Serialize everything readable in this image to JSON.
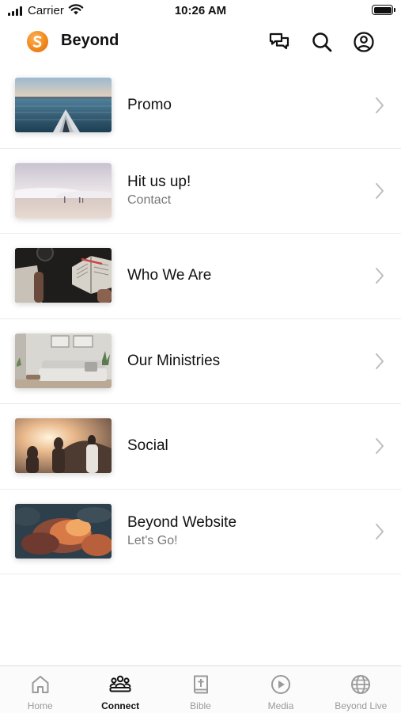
{
  "status_bar": {
    "carrier": "Carrier",
    "time": "10:26 AM"
  },
  "header": {
    "title": "Beyond",
    "icons": [
      "chat-icon",
      "search-icon",
      "account-icon"
    ]
  },
  "list": {
    "items": [
      {
        "title": "Promo",
        "subtitle": "",
        "thumbnail": "kayak-on-water-image"
      },
      {
        "title": "Hit us up!",
        "subtitle": "Contact",
        "thumbnail": "beach-waves-image"
      },
      {
        "title": "Who We Are",
        "subtitle": "",
        "thumbnail": "open-bible-image"
      },
      {
        "title": "Our Ministries",
        "subtitle": "",
        "thumbnail": "living-room-image"
      },
      {
        "title": "Social",
        "subtitle": "",
        "thumbnail": "friends-sunset-image"
      },
      {
        "title": "Beyond Website",
        "subtitle": "Let's Go!",
        "thumbnail": "sunset-clouds-image"
      }
    ]
  },
  "tab_bar": {
    "tabs": [
      {
        "label": "Home",
        "icon": "home-icon",
        "active": false
      },
      {
        "label": "Connect",
        "icon": "people-icon",
        "active": true
      },
      {
        "label": "Bible",
        "icon": "bible-icon",
        "active": false
      },
      {
        "label": "Media",
        "icon": "play-icon",
        "active": false
      },
      {
        "label": "Beyond Live",
        "icon": "globe-icon",
        "active": false
      }
    ]
  },
  "colors": {
    "brand": "#f08a1c",
    "active_tab": "#111111",
    "inactive_tab": "#9a9a9a",
    "subtitle": "#777777",
    "divider": "#ebebeb"
  }
}
